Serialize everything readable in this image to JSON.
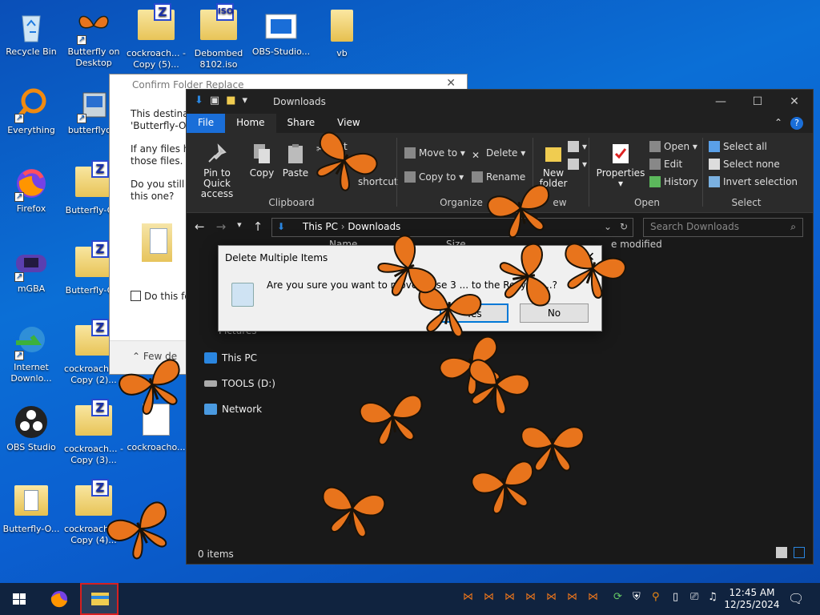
{
  "desktop": {
    "icons": [
      {
        "label": "Recycle Bin"
      },
      {
        "label": "Butterfly on Desktop"
      },
      {
        "label": "cockroach... - Copy (5)..."
      },
      {
        "label": "Debombed 8102.iso"
      },
      {
        "label": "OBS-Studio..."
      },
      {
        "label": "vb"
      },
      {
        "label": "Everything"
      },
      {
        "label": "butterflyo..."
      },
      {
        "label": "Firefox"
      },
      {
        "label": "Butterfly-O..."
      },
      {
        "label": "mGBA"
      },
      {
        "label": "Butterfly-O..."
      },
      {
        "label": "Internet Downlo..."
      },
      {
        "label": "cockroach... - Copy (2)..."
      },
      {
        "label": "OBS Studio"
      },
      {
        "label": "cockroach... - Copy (3)..."
      },
      {
        "label": "cockroacho..."
      },
      {
        "label": "Butterfly-O..."
      },
      {
        "label": "cockroach... - Copy (4)..."
      }
    ]
  },
  "confirm_replace": {
    "title": "Confirm Folder Replace",
    "line1": "This destinati",
    "line2": "'Butterfly-On",
    "line3": "If any files ha",
    "line4": "those files.",
    "line5": "Do you still w",
    "line6": "this one?",
    "checkbox": "Do this fo",
    "footer": "Few de"
  },
  "explorer": {
    "title": "Downloads",
    "tabs": {
      "file": "File",
      "home": "Home",
      "share": "Share",
      "view": "View"
    },
    "ribbon": {
      "pin": "Pin to Quick access",
      "copy": "Copy",
      "paste": "Paste",
      "cut": "Cut",
      "copy_path": "th",
      "paste_shortcut": "shortcut",
      "clipboard": "Clipboard",
      "move_to": "Move to",
      "copy_to": "Copy to",
      "delete": "Delete",
      "rename": "Rename",
      "organize": "Organize",
      "new_folder": "New folder",
      "new": "ew",
      "properties": "Properties",
      "open": "Open",
      "edit": "Edit",
      "history": "History",
      "open_group": "Open",
      "select_all": "Select all",
      "select_none": "Select none",
      "invert_selection": "Invert selection",
      "select_group": "Select"
    },
    "address": {
      "this_pc": "This PC",
      "downloads": "Downloads"
    },
    "search_placeholder": "Search Downloads",
    "columns": {
      "name": "Name",
      "size": "Size",
      "date": "e modified"
    },
    "nav": {
      "pictures": "Pictures",
      "this_pc": "This PC",
      "tools": "TOOLS (D:)",
      "network": "Network"
    },
    "status": "0 items"
  },
  "delete_dialog": {
    "title": "Delete Multiple Items",
    "message": "Are you sure you want to move these 3 ... to the Recycle ...?",
    "yes": "Yes",
    "no": "No"
  },
  "taskbar": {
    "time": "12:45 AM",
    "date": "12/25/2024"
  },
  "colors": {
    "accent": "#1a6ed8",
    "butterfly": "#e8741c"
  }
}
